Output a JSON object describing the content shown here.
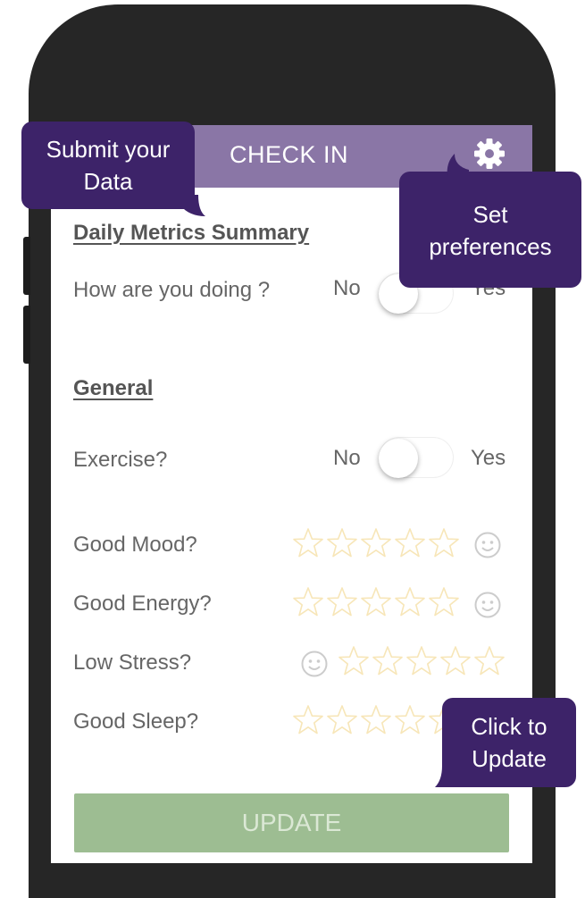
{
  "header": {
    "title": "CHECK IN"
  },
  "summary": {
    "title": "Daily Metrics Summary",
    "question": "How are you doing ?",
    "no_label": "No",
    "yes_label": "Yes"
  },
  "general": {
    "title": "General",
    "exercise": {
      "label": "Exercise?",
      "no_label": "No",
      "yes_label": "Yes"
    },
    "ratings": [
      {
        "label": "Good Mood?",
        "stars": 0
      },
      {
        "label": "Good Energy?",
        "stars": 0
      },
      {
        "label": "Low Stress?",
        "stars": 0
      },
      {
        "label": "Good Sleep?",
        "stars": 0
      }
    ]
  },
  "update_button": {
    "label": "UPDATE"
  },
  "callouts": {
    "submit": "Submit your Data",
    "preferences": "Set preferences",
    "update": "Click to Update"
  },
  "colors": {
    "header": "#8a76a6",
    "callout": "#3d2369",
    "update_button": "#9dbd92",
    "star_outline": "#f7e6b8"
  },
  "icons": [
    "gear-icon",
    "star-icon",
    "smiley-icon"
  ]
}
